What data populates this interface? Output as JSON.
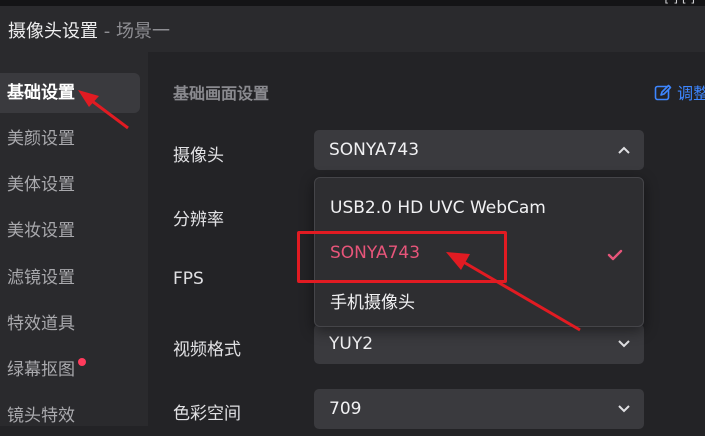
{
  "top_strip": {
    "text": "[-] [ ]"
  },
  "window": {
    "title": "摄像头设置",
    "separator": " - ",
    "scene": "场景一"
  },
  "sidebar": {
    "items": [
      {
        "label": "基础设置",
        "active": true
      },
      {
        "label": "美颜设置"
      },
      {
        "label": "美体设置"
      },
      {
        "label": "美妆设置"
      },
      {
        "label": "滤镜设置"
      },
      {
        "label": "特效道具"
      },
      {
        "label": "绿幕抠图",
        "badge": true
      },
      {
        "label": "镜头特效"
      }
    ]
  },
  "main": {
    "section_title": "基础画面设置",
    "adjust_label": "调整",
    "rows": [
      {
        "label": "摄像头",
        "value": "SONYA743",
        "expanded": true
      },
      {
        "label": "分辨率"
      },
      {
        "label": "FPS"
      },
      {
        "label": "视频格式",
        "value": "YUY2"
      },
      {
        "label": "色彩空间",
        "value": "709"
      }
    ],
    "camera_dropdown": {
      "options": [
        "USB2.0 HD UVC WebCam",
        "SONYA743",
        "手机摄像头"
      ],
      "selected": "SONYA743"
    }
  },
  "colors": {
    "accent_blue": "#3d86ff",
    "selected_pink": "#e7557a",
    "annotation_red": "#e11b22",
    "badge_red": "#ff3b5c"
  }
}
